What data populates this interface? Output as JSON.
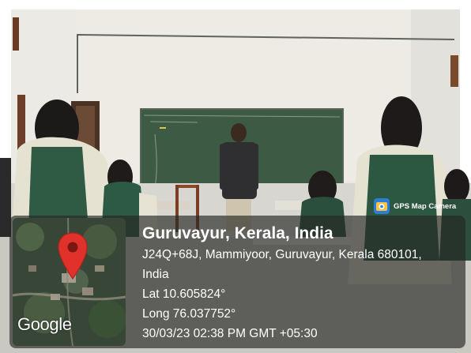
{
  "stamp": {
    "brand_label": "GPS Map Camera",
    "location_title": "Guruvayur, Kerala, India",
    "address_line_1": "J24Q+68J, Mammiyoor, Guruvayur, Kerala 680101,",
    "address_line_2": "India",
    "latitude": "Lat 10.605824°",
    "longitude": "Long 76.037752°",
    "datetime": "30/03/23 02:38 PM GMT +05:30"
  },
  "map": {
    "attribution": "Google",
    "pin_color": "#e0312b"
  },
  "icons": {
    "map_pin": "map-pin-icon",
    "app_logo": "gps-map-camera-icon"
  },
  "colors": {
    "overlay_background": "#262824",
    "chalkboard": "#3c5a44"
  }
}
